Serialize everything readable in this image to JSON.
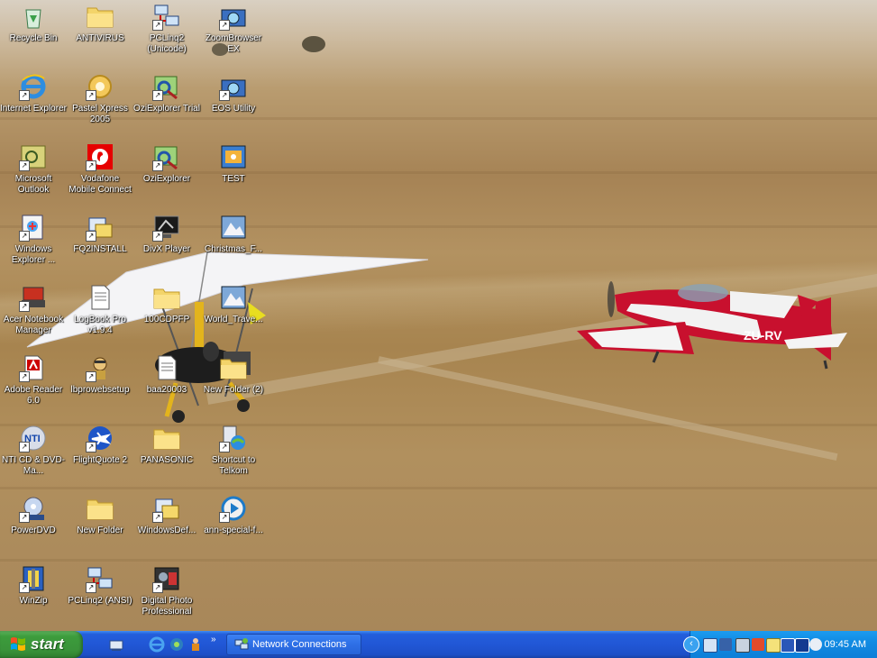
{
  "desktop": {
    "icons": [
      {
        "name": "recycle-bin",
        "label": "Recycle Bin",
        "glyph": "recycle-bin-icon"
      },
      {
        "name": "antivirus",
        "label": "ANTIVIRUS",
        "glyph": "folder-icon"
      },
      {
        "name": "pclinq2-unicode",
        "label": "PCLinq2 (Unicode)",
        "glyph": "network-icon"
      },
      {
        "name": "zoombrowser-ex",
        "label": "ZoomBrowser EX",
        "glyph": "camera-icon"
      },
      {
        "name": "internet-explorer",
        "label": "Internet Explorer",
        "glyph": "ie-icon"
      },
      {
        "name": "pastel-xpress",
        "label": "Pastel Xpress 2005",
        "glyph": "disc-icon"
      },
      {
        "name": "ozi-trial",
        "label": "OziExplorer Trial",
        "glyph": "map-icon"
      },
      {
        "name": "eos-utility",
        "label": "EOS Utility",
        "glyph": "camera-icon"
      },
      {
        "name": "ms-outlook",
        "label": "Microsoft Outlook",
        "glyph": "outlook-icon"
      },
      {
        "name": "vodafone",
        "label": "Vodafone Mobile Connect",
        "glyph": "vodafone-icon"
      },
      {
        "name": "oziexplorer",
        "label": "OziExplorer",
        "glyph": "map-icon"
      },
      {
        "name": "test",
        "label": "TEST",
        "glyph": "image-icon"
      },
      {
        "name": "windows-explorer",
        "label": "Windows Explorer ...",
        "glyph": "explorer-icon"
      },
      {
        "name": "fq2install",
        "label": "FQ2INSTALL",
        "glyph": "installer-icon"
      },
      {
        "name": "divx-player",
        "label": "DivX Player",
        "glyph": "monitor-icon"
      },
      {
        "name": "christmas",
        "label": "Christmas_F...",
        "glyph": "picture-icon"
      },
      {
        "name": "acer-notebook",
        "label": "Acer Notebook Manager",
        "glyph": "notebook-icon"
      },
      {
        "name": "logbook-pro",
        "label": "LogBook Pro v1.9.4",
        "glyph": "document-icon"
      },
      {
        "name": "100cdpfp",
        "label": "100CDPFP",
        "glyph": "folder-icon"
      },
      {
        "name": "world-travel",
        "label": "World_Trave...",
        "glyph": "picture-icon"
      },
      {
        "name": "adobe-reader",
        "label": "Adobe Reader 6.0",
        "glyph": "pdf-icon"
      },
      {
        "name": "lbprowebsetup",
        "label": "lbprowebsetup",
        "glyph": "pilot-icon"
      },
      {
        "name": "baa20003",
        "label": "baa20003",
        "glyph": "document-icon"
      },
      {
        "name": "new-folder-2",
        "label": "New Folder (2)",
        "glyph": "folder-icon"
      },
      {
        "name": "nti-cd-dvd",
        "label": "NTI CD & DVD-Ma...",
        "glyph": "nti-icon"
      },
      {
        "name": "flightquote-2",
        "label": "FlightQuote 2",
        "glyph": "plane-icon"
      },
      {
        "name": "panasonic",
        "label": "PANASONIC",
        "glyph": "folder-icon"
      },
      {
        "name": "telkom",
        "label": "Shortcut to Telkom",
        "glyph": "globe-icon"
      },
      {
        "name": "powerdvd",
        "label": "PowerDVD",
        "glyph": "dvd-icon"
      },
      {
        "name": "new-folder",
        "label": "New Folder",
        "glyph": "folder-icon"
      },
      {
        "name": "windowsdef",
        "label": "WindowsDef...",
        "glyph": "installer-icon"
      },
      {
        "name": "ann-special",
        "label": "ann-special-f...",
        "glyph": "media-icon"
      },
      {
        "name": "winzip",
        "label": "WinZip",
        "glyph": "zip-icon"
      },
      {
        "name": "pclinq2-ansi",
        "label": "PCLinq2 (ANSI)",
        "glyph": "network-icon"
      },
      {
        "name": "digital-photo-pro",
        "label": "Digital Photo Professional",
        "glyph": "photo-icon"
      }
    ]
  },
  "taskbar": {
    "start_label": "start",
    "task_label": "Network Connections",
    "clock": "09:45 AM",
    "quicklaunch": [
      "show-desktop-icon",
      "ie-icon",
      "media-icon",
      "user-icon"
    ]
  },
  "colors": {
    "taskbar": "#245edb",
    "start": "#3c9c3c",
    "tray": "#118be3"
  }
}
